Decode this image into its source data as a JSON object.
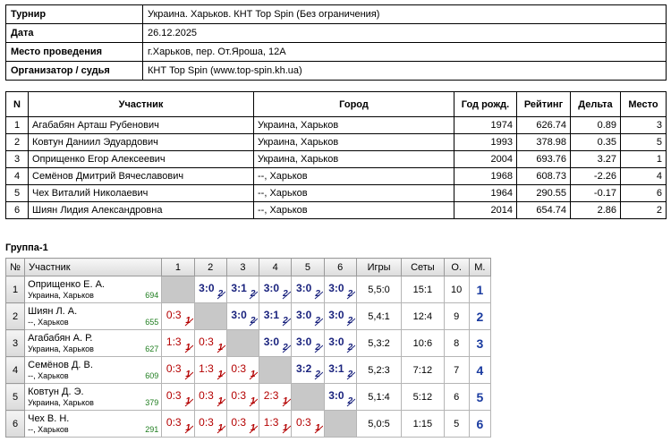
{
  "info": [
    {
      "key": "Турнир",
      "value": "Украина. Харьков. КНТ Top Spin (Без ограничения)"
    },
    {
      "key": "Дата",
      "value": "26.12.2025"
    },
    {
      "key": "Место проведения",
      "value": "г.Харьков, пер. От.Яроша, 12А"
    },
    {
      "key": "Организатор / судья",
      "value": "КНТ Top Spin (www.top-spin.kh.ua)"
    }
  ],
  "participants": {
    "headers": [
      "N",
      "Участник",
      "Город",
      "Год рожд.",
      "Рейтинг",
      "Дельта",
      "Место"
    ],
    "rows": [
      {
        "n": "1",
        "name": "Агабабян Арташ Рубенович",
        "city": "Украина, Харьков",
        "year": "1974",
        "rating": "626.74",
        "delta": "0.89",
        "place": "3"
      },
      {
        "n": "2",
        "name": "Ковтун Даниил Эдуардович",
        "city": "Украина, Харьков",
        "year": "1993",
        "rating": "378.98",
        "delta": "0.35",
        "place": "5"
      },
      {
        "n": "3",
        "name": "Оприщенко Егор Алексеевич",
        "city": "Украина, Харьков",
        "year": "2004",
        "rating": "693.76",
        "delta": "3.27",
        "place": "1"
      },
      {
        "n": "4",
        "name": "Семёнов Дмитрий Вячеславович",
        "city": "--, Харьков",
        "year": "1968",
        "rating": "608.73",
        "delta": "-2.26",
        "place": "4"
      },
      {
        "n": "5",
        "name": "Чех Виталий Николаевич",
        "city": "--, Харьков",
        "year": "1964",
        "rating": "290.55",
        "delta": "-0.17",
        "place": "6"
      },
      {
        "n": "6",
        "name": "Шиян Лидия Александровна",
        "city": "--, Харьков",
        "year": "2014",
        "rating": "654.74",
        "delta": "2.86",
        "place": "2"
      }
    ]
  },
  "group": {
    "title": "Группа-1",
    "headers": [
      "№",
      "Участник",
      "1",
      "2",
      "3",
      "4",
      "5",
      "6",
      "Игры",
      "Сеты",
      "О.",
      "М."
    ],
    "rows": [
      {
        "n": "1",
        "name": "Оприщенко Е. А.",
        "city": "Украина, Харьков",
        "rating": "694",
        "cells": [
          {
            "self": true
          },
          {
            "score": "3:0",
            "bonus": "2",
            "win": true
          },
          {
            "score": "3:1",
            "bonus": "2",
            "win": true
          },
          {
            "score": "3:0",
            "bonus": "2",
            "win": true
          },
          {
            "score": "3:0",
            "bonus": "2",
            "win": true
          },
          {
            "score": "3:0",
            "bonus": "2",
            "win": true
          }
        ],
        "games": "5,5:0",
        "sets": "15:1",
        "points": "10",
        "place": "1"
      },
      {
        "n": "2",
        "name": "Шиян Л. А.",
        "city": "--, Харьков",
        "rating": "655",
        "cells": [
          {
            "score": "0:3",
            "bonus": "1",
            "win": false
          },
          {
            "self": true
          },
          {
            "score": "3:0",
            "bonus": "2",
            "win": true
          },
          {
            "score": "3:1",
            "bonus": "2",
            "win": true
          },
          {
            "score": "3:0",
            "bonus": "2",
            "win": true
          },
          {
            "score": "3:0",
            "bonus": "2",
            "win": true
          }
        ],
        "games": "5,4:1",
        "sets": "12:4",
        "points": "9",
        "place": "2"
      },
      {
        "n": "3",
        "name": "Агабабян А. Р.",
        "city": "Украина, Харьков",
        "rating": "627",
        "cells": [
          {
            "score": "1:3",
            "bonus": "1",
            "win": false
          },
          {
            "score": "0:3",
            "bonus": "1",
            "win": false
          },
          {
            "self": true
          },
          {
            "score": "3:0",
            "bonus": "2",
            "win": true
          },
          {
            "score": "3:0",
            "bonus": "2",
            "win": true
          },
          {
            "score": "3:0",
            "bonus": "2",
            "win": true
          }
        ],
        "games": "5,3:2",
        "sets": "10:6",
        "points": "8",
        "place": "3"
      },
      {
        "n": "4",
        "name": "Семёнов Д. В.",
        "city": "--, Харьков",
        "rating": "609",
        "cells": [
          {
            "score": "0:3",
            "bonus": "1",
            "win": false
          },
          {
            "score": "1:3",
            "bonus": "1",
            "win": false
          },
          {
            "score": "0:3",
            "bonus": "1",
            "win": false
          },
          {
            "self": true
          },
          {
            "score": "3:2",
            "bonus": "2",
            "win": true
          },
          {
            "score": "3:1",
            "bonus": "2",
            "win": true
          }
        ],
        "games": "5,2:3",
        "sets": "7:12",
        "points": "7",
        "place": "4"
      },
      {
        "n": "5",
        "name": "Ковтун Д. Э.",
        "city": "Украина, Харьков",
        "rating": "379",
        "cells": [
          {
            "score": "0:3",
            "bonus": "1",
            "win": false
          },
          {
            "score": "0:3",
            "bonus": "1",
            "win": false
          },
          {
            "score": "0:3",
            "bonus": "1",
            "win": false
          },
          {
            "score": "2:3",
            "bonus": "1",
            "win": false
          },
          {
            "self": true
          },
          {
            "score": "3:0",
            "bonus": "2",
            "win": true
          }
        ],
        "games": "5,1:4",
        "sets": "5:12",
        "points": "6",
        "place": "5"
      },
      {
        "n": "6",
        "name": "Чех В. Н.",
        "city": "--, Харьков",
        "rating": "291",
        "cells": [
          {
            "score": "0:3",
            "bonus": "1",
            "win": false
          },
          {
            "score": "0:3",
            "bonus": "1",
            "win": false
          },
          {
            "score": "0:3",
            "bonus": "1",
            "win": false
          },
          {
            "score": "1:3",
            "bonus": "1",
            "win": false
          },
          {
            "score": "0:3",
            "bonus": "1",
            "win": false
          },
          {
            "self": true
          }
        ],
        "games": "5,0:5",
        "sets": "1:15",
        "points": "5",
        "place": "6"
      }
    ]
  }
}
